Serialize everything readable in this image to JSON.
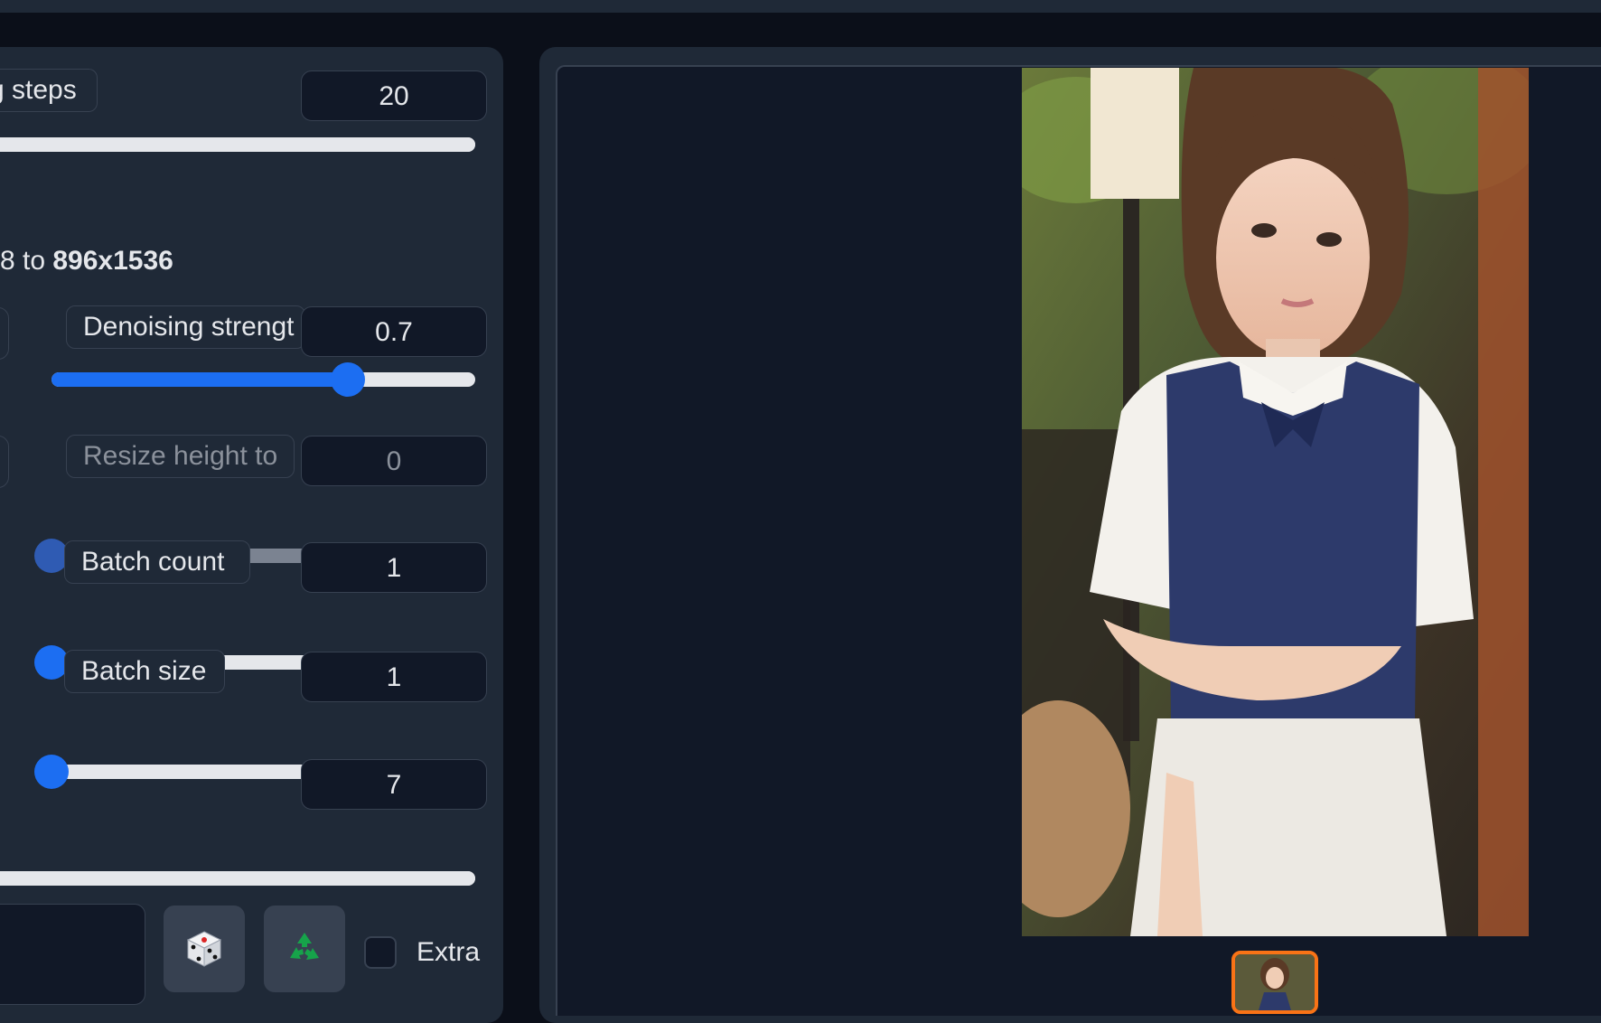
{
  "sliders": {
    "sampling_steps": {
      "label": "g steps",
      "value": "20",
      "fraction": 1.0
    },
    "resize_summary": {
      "prefix": "8 to ",
      "size": "896x1536"
    },
    "denoising_strength": {
      "label": "Denoising strengt",
      "value": "0.7",
      "fraction": 0.7
    },
    "resize_height": {
      "label": "Resize height to",
      "value": "0",
      "fraction": 0.0
    },
    "batch_count": {
      "label": "Batch count",
      "value": "1",
      "fraction": 0.0
    },
    "batch_size": {
      "label": "Batch size",
      "value": "1",
      "fraction": 0.0
    },
    "cfg_scale": {
      "value": "7",
      "fraction": 1.0
    }
  },
  "seed_row": {
    "random_icon": "dice-icon",
    "reuse_icon": "recycle-icon",
    "extra_label": "Extra",
    "extra_checked": false
  },
  "colors": {
    "accent": "#1c6ef2",
    "panel": "#1f2937",
    "background": "#0b0f19",
    "selected_thumb": "#f97316"
  }
}
